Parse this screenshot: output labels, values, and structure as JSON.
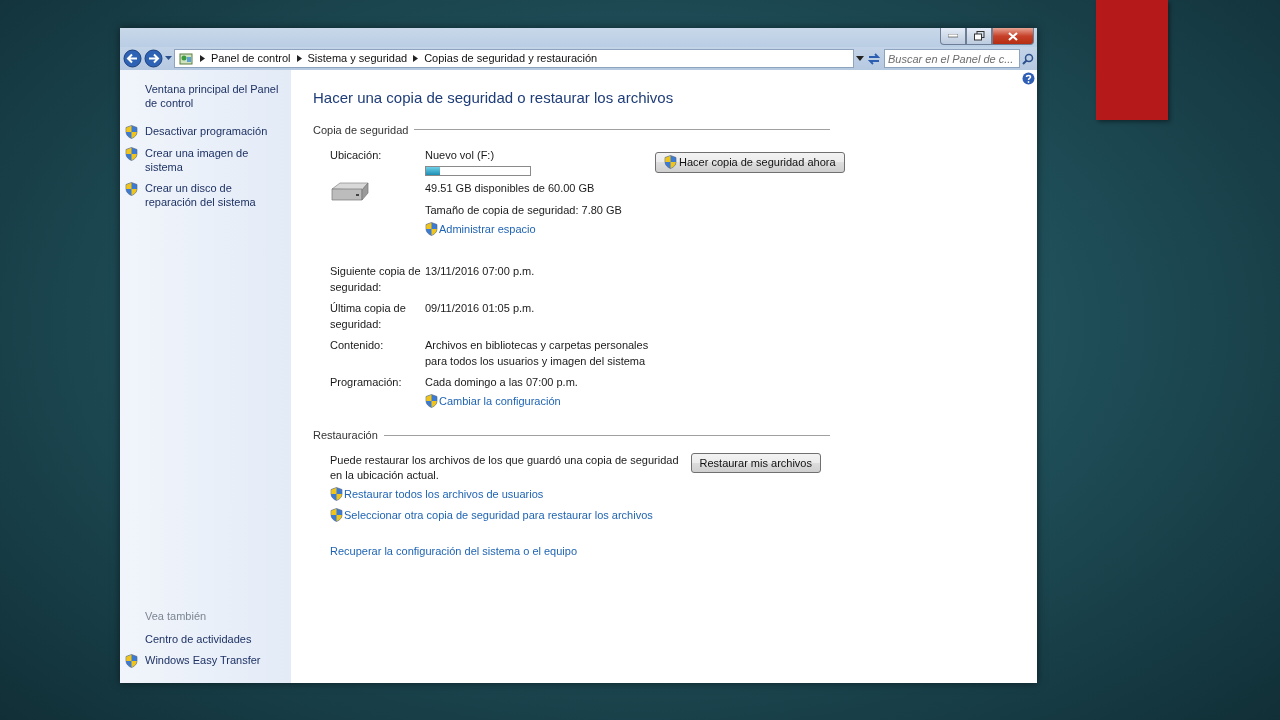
{
  "address_bar": {
    "breadcrumbs": [
      "Panel de control",
      "Sistema y seguridad",
      "Copias de seguridad y restauración"
    ],
    "search": {
      "placeholder": "Buscar en el Panel de c..."
    }
  },
  "sidebar": {
    "items": [
      {
        "label": "Ventana principal del Panel de control",
        "shield": false
      },
      {
        "label": "Desactivar programación",
        "shield": true
      },
      {
        "label": "Crear una imagen de sistema",
        "shield": true
      },
      {
        "label": "Crear un disco de reparación del sistema",
        "shield": true
      }
    ],
    "see_also_heading": "Vea también",
    "see_also": [
      {
        "label": "Centro de actividades",
        "shield": false
      },
      {
        "label": "Windows Easy Transfer",
        "shield": true
      }
    ]
  },
  "title": "Hacer una copia de seguridad o restaurar los archivos",
  "backup": {
    "heading": "Copia de seguridad",
    "location_label": "Ubicación:",
    "drive": "Nuevo vol (F:)",
    "usage": {
      "level": 0.13
    },
    "available": "49.51 GB disponibles de 60.00 GB",
    "size": "Tamaño de copia de seguridad: 7.80 GB",
    "manage_link": "Administrar espacio",
    "button": "Hacer copia de seguridad ahora",
    "details": [
      {
        "label": "Siguiente copia de seguridad:",
        "value": "13/11/2016 07:00 p.m."
      },
      {
        "label": "Última copia de seguridad:",
        "value": "09/11/2016 01:05 p.m."
      },
      {
        "label": "Contenido:",
        "value": "Archivos en bibliotecas y carpetas personales para todos los usuarios y imagen del sistema"
      },
      {
        "label": "Programación:",
        "value": "Cada domingo a las 07:00 p.m.",
        "link": "Cambiar la configuración"
      }
    ]
  },
  "restore": {
    "heading": "Restauración",
    "text": "Puede restaurar los archivos de los que guardó una copia de seguridad en la ubicación actual.",
    "button": "Restaurar mis archivos",
    "links": [
      {
        "label": "Restaurar todos los archivos de usuarios",
        "shield": true
      },
      {
        "label": "Seleccionar otra copia de seguridad para restaurar los archivos",
        "shield": true
      }
    ],
    "recover_link": "Recuperar la configuración del sistema o el equipo"
  }
}
